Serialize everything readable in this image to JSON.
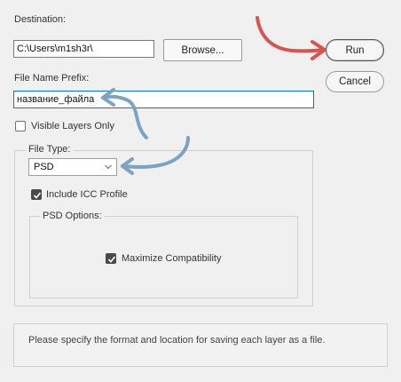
{
  "destination": {
    "label": "Destination:",
    "path_value": "C:\\Users\\m1sh3r\\",
    "browse_label": "Browse..."
  },
  "buttons": {
    "run_label": "Run",
    "cancel_label": "Cancel"
  },
  "prefix": {
    "label": "File Name Prefix:",
    "value": "название_файла"
  },
  "visible_layers": {
    "label": "Visible Layers Only",
    "checked": false
  },
  "file_type": {
    "label": "File Type:",
    "selected": "PSD",
    "include_icc_label": "Include ICC Profile",
    "include_icc_checked": true
  },
  "psd_options": {
    "label": "PSD Options:",
    "maximize_label": "Maximize Compatibility",
    "maximize_checked": true
  },
  "info": {
    "text": "Please specify the format and location for saving each layer as a file."
  },
  "colors": {
    "red_arrow": "#d9534f",
    "blue_arrow": "#7ea3bf",
    "focus_border": "#0078d7"
  }
}
